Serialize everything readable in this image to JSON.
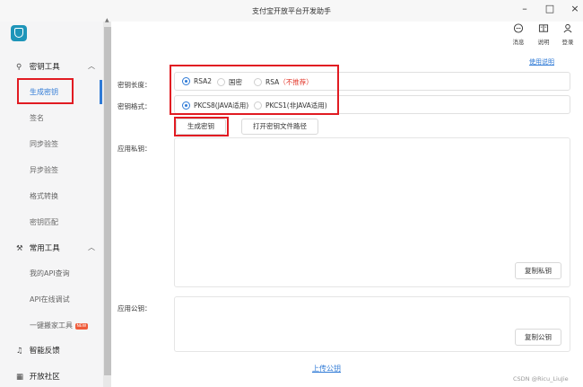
{
  "window": {
    "title": "支付宝开放平台开发助手",
    "minimize": "–",
    "maximize": "□",
    "close": "×"
  },
  "toolbar": {
    "message_label": "消息",
    "docs_label": "说明",
    "login_label": "登录"
  },
  "sidebar": {
    "groups": [
      {
        "label": "密钥工具",
        "items": [
          "生成密钥",
          "签名",
          "同步验签",
          "异步验签",
          "格式转换",
          "密钥匹配"
        ]
      },
      {
        "label": "常用工具",
        "items": [
          "我的API查询",
          "API在线调试",
          "一键搬家工具"
        ],
        "badge": "NEW"
      },
      {
        "label": "智能反馈"
      },
      {
        "label": "开放社区"
      }
    ],
    "active_item": "生成密钥"
  },
  "main": {
    "help_link": "使用说明",
    "key_length": {
      "label": "密钥长度：",
      "options": [
        "RSA2",
        "国密",
        "RSA"
      ],
      "rsa_warning": "（不推荐）",
      "selected": "RSA2"
    },
    "key_format": {
      "label": "密钥格式：",
      "options": [
        "PKCS8(JAVA适用)",
        "PKCS1(非JAVA适用)"
      ],
      "selected": "PKCS8(JAVA适用)"
    },
    "generate_button": "生成密钥",
    "open_path_button": "打开密钥文件路径",
    "private_key": {
      "label": "应用私钥：",
      "value": "",
      "copy_button": "复制私钥"
    },
    "public_key": {
      "label": "应用公钥：",
      "value": "",
      "copy_button": "复制公钥"
    },
    "upload_link": "上传公钥"
  },
  "watermark": "CSDN @Ricu_LiuJie",
  "colors": {
    "accent": "#2f7ad6",
    "annotation_red": "#e11b22",
    "warning": "#e33b2e",
    "logo": "#1e95b9"
  }
}
